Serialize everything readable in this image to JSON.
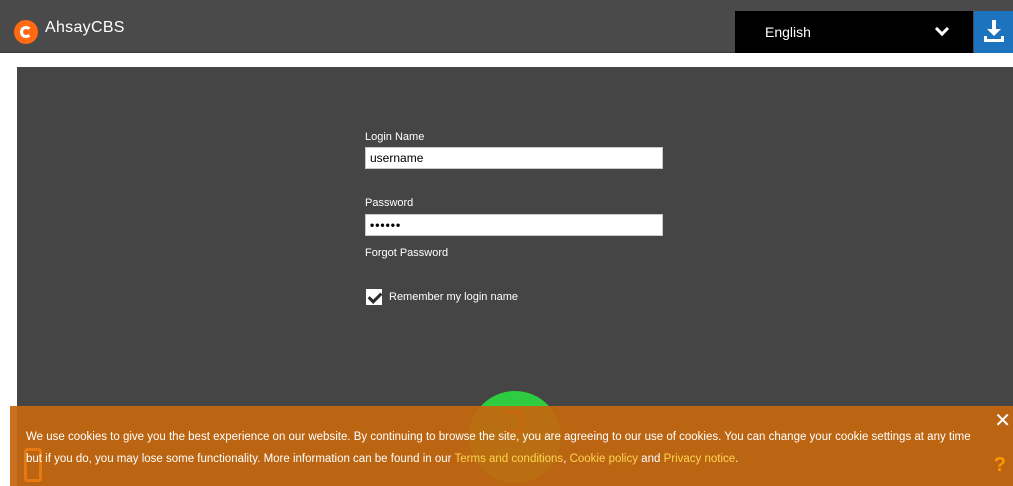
{
  "header": {
    "app_title": "AhsayCBS",
    "logo_icon": "ahsay-logo-icon",
    "language": {
      "selected": "English",
      "icon": "chevron-down-icon"
    },
    "download_icon": "download-icon"
  },
  "login": {
    "login_name_label": "Login Name",
    "login_name_value": "username",
    "password_label": "Password",
    "password_value": "••••••",
    "forgot_password": "Forgot Password",
    "remember_label": "Remember my login name",
    "remember_checked": true,
    "login_icon": "login-icon"
  },
  "cookie_banner": {
    "text_before": "We use cookies to give you the best experience on our website. By continuing to browse the site, you are agreeing to our use of cookies. You can change your cookie settings at any time but if you do, you may lose some functionality. More information can be found in our ",
    "link_terms": "Terms and conditions",
    "sep1": ", ",
    "link_cookie": "Cookie policy",
    "sep2": " and ",
    "link_privacy": "Privacy notice",
    "text_after": ".",
    "close_label": "✕",
    "help_label": "?"
  },
  "colors": {
    "topbar_bg": "#4a4a4a",
    "panel_bg": "#454545",
    "brand_orange": "#ff6a13",
    "download_blue": "#1e73be",
    "login_green": "#2ecc40",
    "banner_orange": "#c4670e",
    "link_yellow": "#ffd54f"
  }
}
